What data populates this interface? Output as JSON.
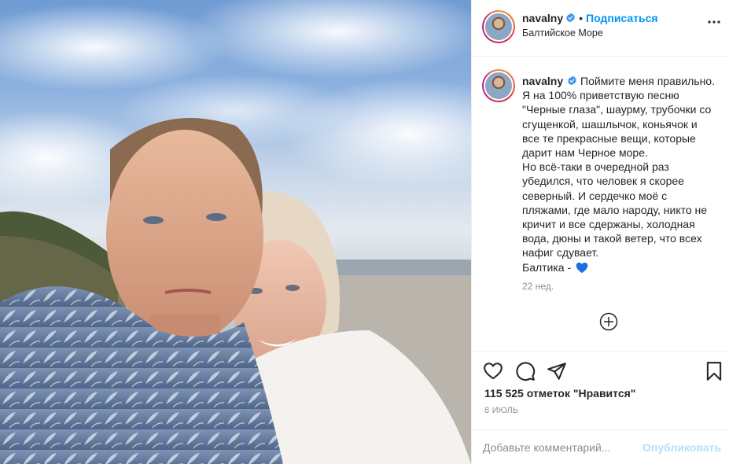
{
  "post": {
    "image": {
      "sky_colors": [
        "#6f9bd3",
        "#c9d8ea"
      ],
      "description_icon": "selfie-photo"
    }
  },
  "header": {
    "username": "navalny",
    "separator": "•",
    "follow_label": "Подписаться",
    "location": "Балтийское Море",
    "more_icon": "more-horizontal-icon"
  },
  "caption": {
    "username": "navalny",
    "lines": [
      "Поймите меня правильно.",
      "Я на 100% приветствую песню",
      "\"Черные глаза\", шаурму, трубочки со",
      "сгущенкой, шашлычок, коньячок и",
      "все те прекрасные вещи, которые",
      "дарит нам Черное море.",
      "Но всё-таки в очередной раз",
      "убедился, что человек я скорее",
      "северный. И сердечко моё с",
      "пляжами, где мало народу, никто не",
      "кричит и все сдержаны, холодная",
      "вода, дюны и такой ветер, что всех",
      "нафиг сдувает.",
      "Балтика -"
    ],
    "emoji": "blue-heart",
    "age": "22 нед."
  },
  "actions": {
    "like_icon": "heart-icon",
    "comment_icon": "comment-icon",
    "share_icon": "share-icon",
    "save_icon": "bookmark-icon"
  },
  "likes_text": "115 525 отметок \"Нравится\"",
  "date": "8 ИЮЛЬ",
  "comment": {
    "placeholder": "Добавьте комментарий...",
    "publish_label": "Опубликовать"
  },
  "colors": {
    "accent": "#0095f6",
    "publish_disabled": "#b2dffc",
    "muted": "#8e8e8e",
    "border": "#efefef",
    "verified": "#3897f0",
    "heart_emoji": "#1a6fe0"
  }
}
